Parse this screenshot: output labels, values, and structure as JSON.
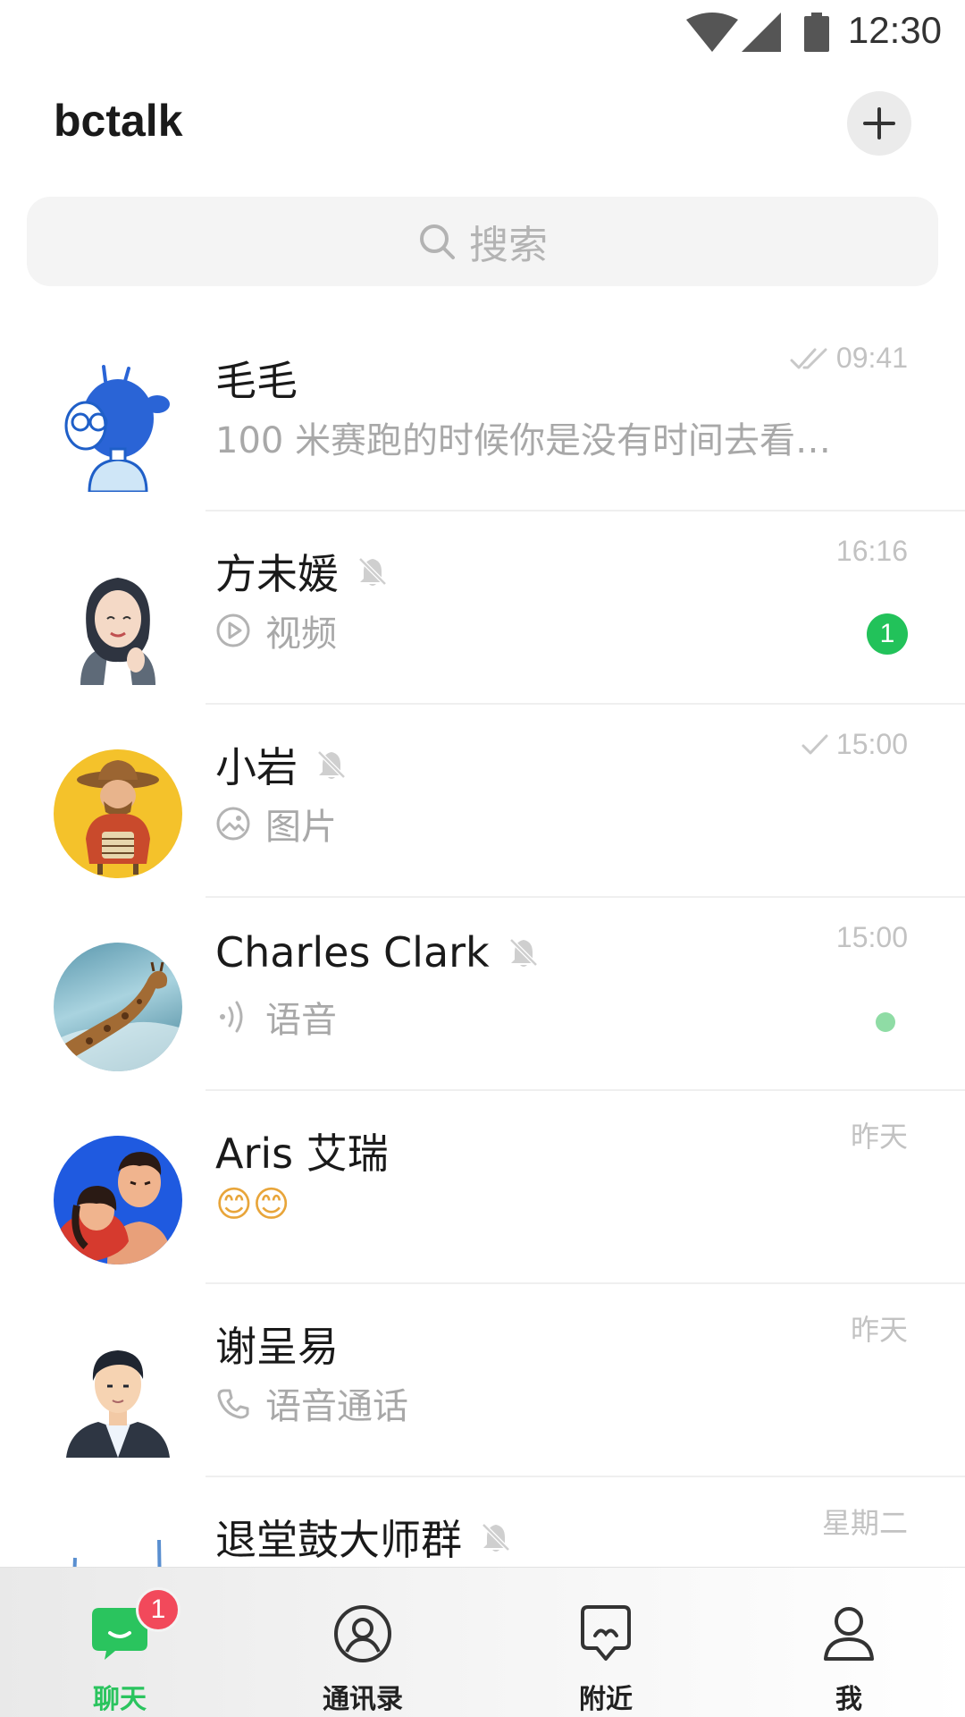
{
  "status_bar": {
    "time": "12:30"
  },
  "header": {
    "title": "bctalk",
    "add_icon": "plus-icon"
  },
  "search": {
    "placeholder": "搜索",
    "icon": "search-icon"
  },
  "chats": [
    {
      "name": "毛毛",
      "preview": "100 米赛跑的时候你是没有时间去看…",
      "time": "09:41",
      "read_status": "double-check",
      "muted": false,
      "preview_icon": "",
      "avatar": "blue-robot-girl"
    },
    {
      "name": "方未媛",
      "preview": "视频",
      "time": "16:16",
      "read_status": "",
      "muted": true,
      "preview_icon": "play-icon",
      "unread_count": "1",
      "avatar": "woman-illustration"
    },
    {
      "name": "小岩",
      "preview": "图片",
      "time": "15:00",
      "read_status": "check",
      "muted": true,
      "preview_icon": "image-icon",
      "avatar": "cowboy-yellow"
    },
    {
      "name": "Charles Clark",
      "preview": "语音",
      "time": "15:00",
      "read_status": "",
      "muted": true,
      "preview_icon": "voice-icon",
      "unread_dot": true,
      "avatar": "giraffe-photo"
    },
    {
      "name": "Aris 艾瑞",
      "preview": "😊😊",
      "time": "昨天",
      "read_status": "",
      "muted": false,
      "preview_icon": "",
      "avatar": "couple-illustration"
    },
    {
      "name": "谢呈易",
      "preview": "语音通话",
      "time": "昨天",
      "read_status": "",
      "muted": false,
      "preview_icon": "phone-icon",
      "avatar": "man-illustration"
    },
    {
      "name": "退堂鼓大师群",
      "preview": "",
      "time": "星期二",
      "read_status": "",
      "muted": true,
      "preview_icon": "",
      "avatar": "group-illustration"
    }
  ],
  "tabs": [
    {
      "label": "聊天",
      "icon": "chat-bubble-icon",
      "active": true,
      "badge": "1"
    },
    {
      "label": "通讯录",
      "icon": "contacts-icon",
      "active": false
    },
    {
      "label": "附近",
      "icon": "nearby-icon",
      "active": false
    },
    {
      "label": "我",
      "icon": "profile-icon",
      "active": false
    }
  ],
  "colors": {
    "accent": "#22c25a",
    "badge_red": "#f2495b",
    "muted_text": "#a8a8a8"
  }
}
